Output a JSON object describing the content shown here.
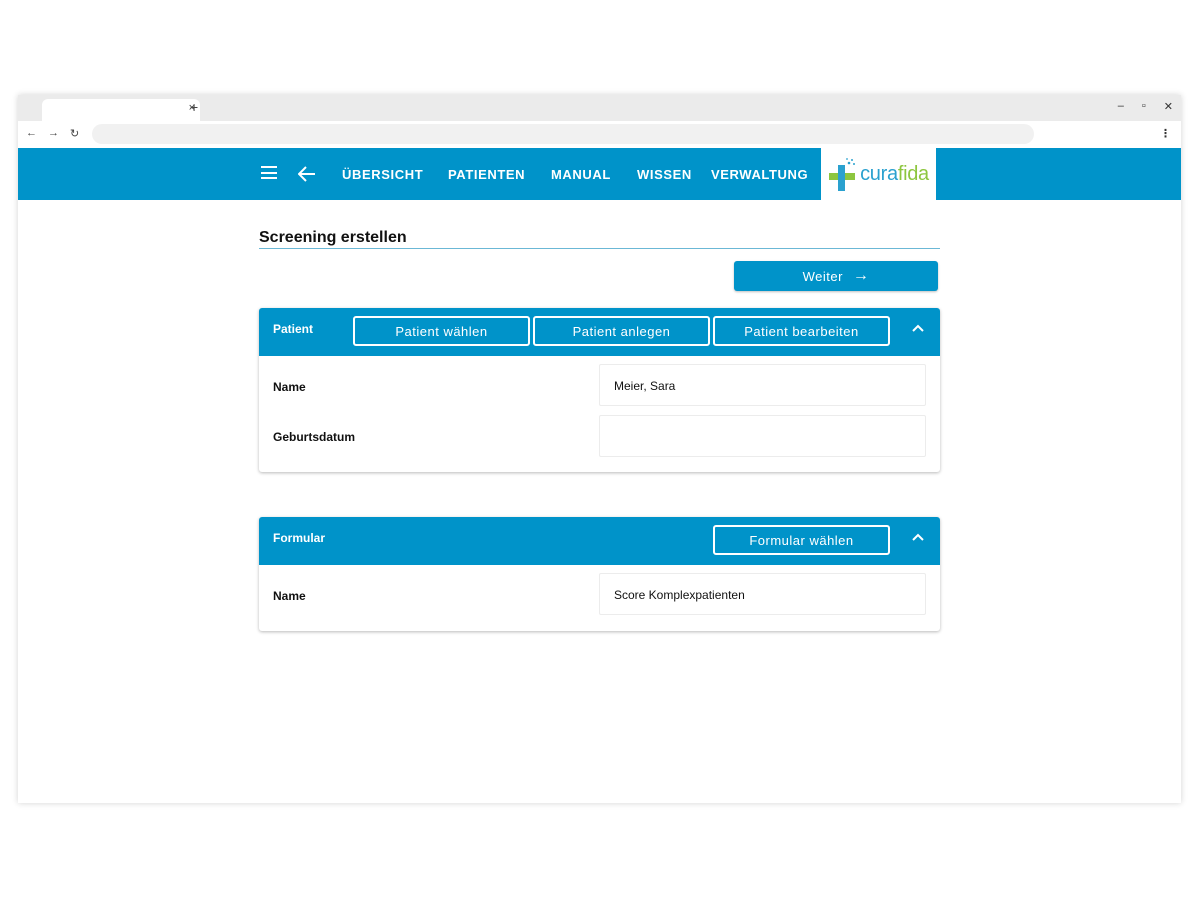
{
  "browser": {
    "tab_close": "×",
    "new_tab": "+",
    "window_controls": [
      "–",
      "▫",
      "✕"
    ],
    "nav": [
      "←",
      "→",
      "↻"
    ],
    "menu": "⋮"
  },
  "appbar": {
    "nav_links": [
      "ÜBERSICHT",
      "PATIENTEN",
      "MANUAL",
      "WISSEN",
      "VERWALTUNG"
    ],
    "logo": {
      "part1": "cura",
      "part2": "fida"
    },
    "colors": {
      "primary": "#0093c9",
      "logo_blue": "#2aa1cf",
      "logo_green": "#8dc63f"
    }
  },
  "page": {
    "title": "Screening erstellen",
    "next_button": "Weiter",
    "next_arrow": "→"
  },
  "patient_card": {
    "title": "Patient",
    "buttons": [
      "Patient wählen",
      "Patient anlegen",
      "Patient bearbeiten"
    ],
    "rows": [
      {
        "label": "Name",
        "value": "Meier, Sara"
      },
      {
        "label": "Geburtsdatum",
        "value": ""
      }
    ]
  },
  "form_card": {
    "title": "Formular",
    "button": "Formular wählen",
    "rows": [
      {
        "label": "Name",
        "value": "Score Komplexpatienten"
      }
    ]
  }
}
